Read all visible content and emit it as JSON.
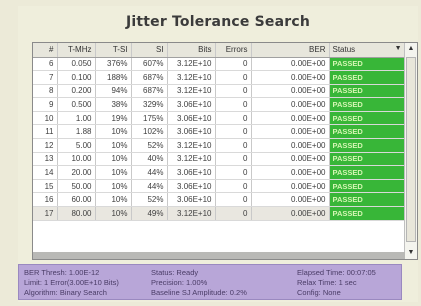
{
  "title": "Jitter Tolerance Search",
  "table": {
    "columns": [
      "#",
      "T-MHz",
      "T-SI",
      "SI",
      "Bits",
      "Errors",
      "BER",
      "Status"
    ],
    "rows": [
      [
        "6",
        "0.050",
        "376%",
        "607%",
        "3.12E+10",
        "0",
        "0.00E+00",
        "PASSED"
      ],
      [
        "7",
        "0.100",
        "188%",
        "687%",
        "3.12E+10",
        "0",
        "0.00E+00",
        "PASSED"
      ],
      [
        "8",
        "0.200",
        "94%",
        "687%",
        "3.12E+10",
        "0",
        "0.00E+00",
        "PASSED"
      ],
      [
        "9",
        "0.500",
        "38%",
        "329%",
        "3.06E+10",
        "0",
        "0.00E+00",
        "PASSED"
      ],
      [
        "10",
        "1.00",
        "19%",
        "175%",
        "3.06E+10",
        "0",
        "0.00E+00",
        "PASSED"
      ],
      [
        "11",
        "1.88",
        "10%",
        "102%",
        "3.06E+10",
        "0",
        "0.00E+00",
        "PASSED"
      ],
      [
        "12",
        "5.00",
        "10%",
        "52%",
        "3.12E+10",
        "0",
        "0.00E+00",
        "PASSED"
      ],
      [
        "13",
        "10.00",
        "10%",
        "40%",
        "3.12E+10",
        "0",
        "0.00E+00",
        "PASSED"
      ],
      [
        "14",
        "20.00",
        "10%",
        "44%",
        "3.06E+10",
        "0",
        "0.00E+00",
        "PASSED"
      ],
      [
        "15",
        "50.00",
        "10%",
        "44%",
        "3.06E+10",
        "0",
        "0.00E+00",
        "PASSED"
      ],
      [
        "16",
        "60.00",
        "10%",
        "52%",
        "3.06E+10",
        "0",
        "0.00E+00",
        "PASSED"
      ],
      [
        "17",
        "80.00",
        "10%",
        "49%",
        "3.12E+10",
        "0",
        "0.00E+00",
        "PASSED"
      ]
    ]
  },
  "status_bar": {
    "ber_thresh": "BER Thresh: 1.00E-12",
    "limit": "Limit: 1 Error(3.00E+10 Bits)",
    "algorithm": "Algorithm: Binary Search",
    "status": "Status: Ready",
    "precision": "Precision: 1.00%",
    "baseline": "Baseline SJ Amplitude: 0.2%",
    "elapsed": "Elapsed Time: 00:07:05",
    "relax": "Relax Time: 1 sec",
    "config": "Config: None"
  },
  "colors": {
    "passed_bg": "#38b638",
    "status_bar_bg": "#b8a6d8"
  }
}
